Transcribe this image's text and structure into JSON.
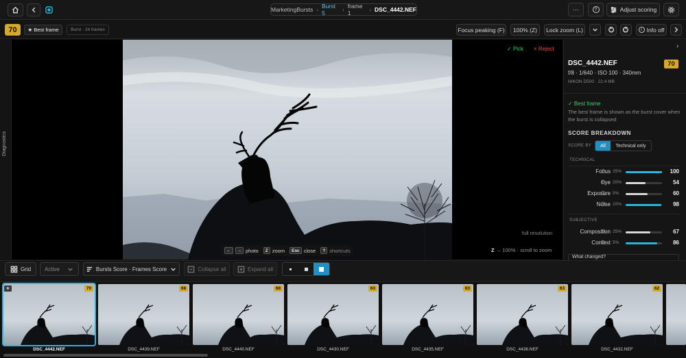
{
  "header": {
    "breadcrumb": [
      "MarketingBursts",
      "Burst 5",
      "frame 1",
      "DSC_4442.NEF"
    ],
    "breadcrumb_sep": "›",
    "more_label": "···",
    "help_label": "?",
    "adjust_scoring_label": "Adjust scoring"
  },
  "subheader": {
    "score": "70",
    "best_frame_label": "★ Best frame",
    "burst_info": "Burst · 24 frames",
    "focus_peaking_label": "Focus peaking (F)",
    "zoom_label": "100% (Z)",
    "lock_zoom_label": "Lock zoom (L)",
    "info_off_label": "Info off",
    "info_glyph": "i"
  },
  "viewer": {
    "diagnostics_label": "Diagnostics",
    "pick_label": "✓ Pick",
    "reject_label": "× Reject",
    "full_resolution_label": "full resolution",
    "zoom_hint_key": "Z",
    "zoom_hint_text": "→ 100% · scroll to zoom",
    "shortcuts": [
      {
        "keys": [
          "←",
          "→"
        ],
        "label": "photo"
      },
      {
        "keys": [
          "Z"
        ],
        "label": "zoom"
      },
      {
        "keys": [
          "Esc"
        ],
        "label": "close"
      },
      {
        "keys": [
          "?"
        ],
        "label": "shortcuts"
      }
    ]
  },
  "panel": {
    "collapse_label": "›",
    "filename": "DSC_4442.NEF",
    "score": "70",
    "exif": "f/8 · 1/640 · ISO 100 · 340mm",
    "camera": "NIKON D500 · 22.4 MB",
    "best_frame_title": "✓ Best frame",
    "best_frame_desc": "The best frame is shown as the burst cover when the burst is collapsed",
    "score_breakdown_title": "SCORE BREAKDOWN",
    "score_by_label": "SCORE BY",
    "score_by_options": [
      "All",
      "Technical only"
    ],
    "technical_label": "TECHNICAL",
    "subjective_label": "SUBJECTIVE",
    "what_changed_label": "What changed?",
    "info_glyph": "i",
    "technical_metrics": [
      {
        "name": "Focus",
        "weight": "25%",
        "value": 100,
        "color": "#29b6e0"
      },
      {
        "name": "Eye",
        "weight": "20%",
        "value": 54,
        "color": "#d9d9d9"
      },
      {
        "name": "Exposure",
        "weight": "5%",
        "value": 60,
        "color": "#d9d9d9"
      },
      {
        "name": "Noise",
        "weight": "10%",
        "value": 98,
        "color": "#29b6e0"
      }
    ],
    "subjective_metrics": [
      {
        "name": "Composition",
        "weight": "25%",
        "value": 67,
        "color": "#d9d9d9"
      },
      {
        "name": "Context",
        "weight": "5%",
        "value": 86,
        "color": "#29b6e0"
      }
    ]
  },
  "toolbar": {
    "grid_label": "Grid",
    "active_label": "Active",
    "sort_label": "Bursts Score · Frames Score",
    "collapse_all_label": "Collapse all",
    "expand_all_label": "Expand all",
    "size_options": [
      "small",
      "medium",
      "large"
    ],
    "selected_size": "large"
  },
  "filmstrip": {
    "star_label": "★",
    "thumbnails": [
      {
        "name": "DSC_4442.NEF",
        "score": "70",
        "selected": true
      },
      {
        "name": "DSC_4439.NEF",
        "score": "68",
        "selected": false
      },
      {
        "name": "DSC_4440.NEF",
        "score": "68",
        "selected": false
      },
      {
        "name": "DSC_4430.NEF",
        "score": "63",
        "selected": false
      },
      {
        "name": "DSC_4435.NEF",
        "score": "63",
        "selected": false
      },
      {
        "name": "DSC_4436.NEF",
        "score": "63",
        "selected": false
      },
      {
        "name": "DSC_4432.NEF",
        "score": "62",
        "selected": false
      }
    ]
  },
  "colors": {
    "accent": "#1f8fc4",
    "score_badge": "#d7a928",
    "pick": "#3bd16b",
    "reject": "#ef4b4b"
  }
}
